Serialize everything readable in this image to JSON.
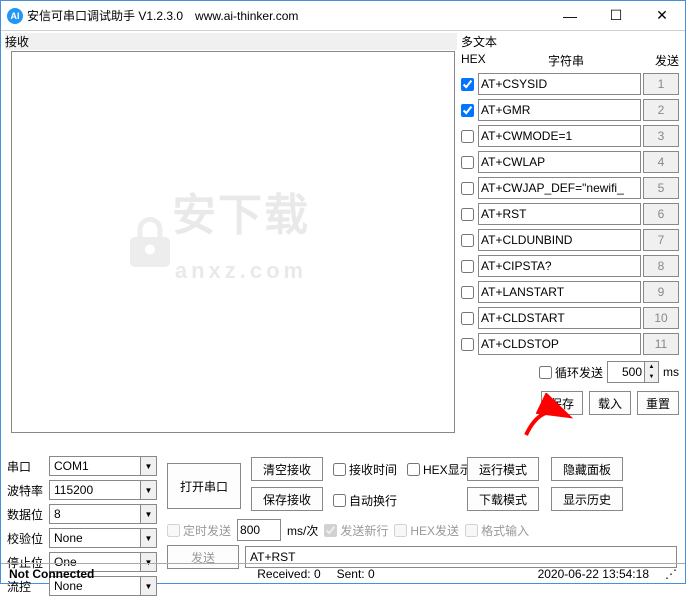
{
  "title": "安信可串口调试助手  V1.2.3.0",
  "url": "www.ai-thinker.com",
  "recv_label": "接收",
  "multi": {
    "title": "多文本",
    "hex": "HEX",
    "strcol": "字符串",
    "sendcol": "发送",
    "rows": [
      {
        "chk": true,
        "txt": "AT+CSYSID",
        "n": "1"
      },
      {
        "chk": true,
        "txt": "AT+GMR",
        "n": "2"
      },
      {
        "chk": false,
        "txt": "AT+CWMODE=1",
        "n": "3"
      },
      {
        "chk": false,
        "txt": "AT+CWLAP",
        "n": "4"
      },
      {
        "chk": false,
        "txt": "AT+CWJAP_DEF=\"newifi_",
        "n": "5"
      },
      {
        "chk": false,
        "txt": "AT+RST",
        "n": "6"
      },
      {
        "chk": false,
        "txt": "AT+CLDUNBIND",
        "n": "7"
      },
      {
        "chk": false,
        "txt": "AT+CIPSTA?",
        "n": "8"
      },
      {
        "chk": false,
        "txt": "AT+LANSTART",
        "n": "9"
      },
      {
        "chk": false,
        "txt": "AT+CLDSTART",
        "n": "10"
      },
      {
        "chk": false,
        "txt": "AT+CLDSTOP",
        "n": "11"
      }
    ],
    "loop_label": "循环发送",
    "loop_ms": "500",
    "ms": "ms",
    "save": "保存",
    "load": "载入",
    "reset": "重置"
  },
  "port": {
    "port_l": "串口",
    "port_v": "COM1",
    "baud_l": "波特率",
    "baud_v": "115200",
    "data_l": "数据位",
    "data_v": "8",
    "par_l": "校验位",
    "par_v": "None",
    "stop_l": "停止位",
    "stop_v": "One",
    "flow_l": "流控",
    "flow_v": "None"
  },
  "open_port": "打开串口",
  "clear_recv": "清空接收",
  "save_recv": "保存接收",
  "chk_recvtime": "接收时间",
  "chk_hexdisp": "HEX显示",
  "chk_autowrap": "自动换行",
  "run_mode": "运行模式",
  "dl_mode": "下载模式",
  "hide_panel": "隐藏面板",
  "show_hist": "显示历史",
  "timed": {
    "label": "定时发送",
    "value": "800",
    "unit": "ms/次",
    "newline": "发送新行",
    "hexsend": "HEX发送",
    "fmtinput": "格式输入"
  },
  "send_btn": "发送",
  "cmd_line": "AT+RST",
  "status": {
    "conn": "Not Connected",
    "recv": "Received: 0",
    "sent": "Sent: 0",
    "time": "2020-06-22 13:54:18"
  }
}
